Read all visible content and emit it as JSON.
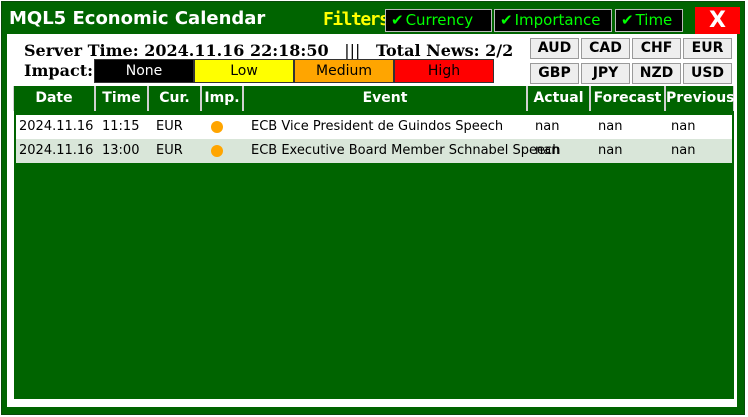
{
  "window": {
    "title": "MQL5 Economic Calendar",
    "close_label": "X"
  },
  "filters": {
    "label": "Filters:",
    "items": [
      {
        "check": "✔",
        "label": "Currency"
      },
      {
        "check": "✔",
        "label": "Importance"
      },
      {
        "check": "✔",
        "label": "Time"
      }
    ]
  },
  "server": {
    "time_label": "Server Time:",
    "time_value": "2024.11.16 22:18:50",
    "separator": "|||",
    "news_label": "Total News:",
    "news_value": "2/2"
  },
  "impact": {
    "label": "Impact:",
    "levels": [
      {
        "label": "None",
        "bg": "#000000",
        "fg": "#ffffff"
      },
      {
        "label": "Low",
        "bg": "#ffff00",
        "fg": "#000000"
      },
      {
        "label": "Medium",
        "bg": "#ffa500",
        "fg": "#000000"
      },
      {
        "label": "High",
        "bg": "#ff0000",
        "fg": "#000000"
      }
    ]
  },
  "currencies": [
    "AUD",
    "CAD",
    "CHF",
    "EUR",
    "GBP",
    "JPY",
    "NZD",
    "USD"
  ],
  "table": {
    "headers": [
      "Date",
      "Time",
      "Cur.",
      "Imp.",
      "Event",
      "Actual",
      "Forecast",
      "Previous"
    ],
    "rows": [
      {
        "date": "2024.11.16",
        "time": "11:15",
        "cur": "EUR",
        "imp_color": "#ffa500",
        "event": "ECB Vice President de Guindos Speech",
        "actual": "nan",
        "forecast": "nan",
        "previous": "nan"
      },
      {
        "date": "2024.11.16",
        "time": "13:00",
        "cur": "EUR",
        "imp_color": "#ffa500",
        "event": "ECB Executive Board Member Schnabel Speech",
        "actual": "nan",
        "forecast": "nan",
        "previous": "nan"
      }
    ]
  },
  "colors": {
    "panel": "#006400",
    "row_alt": "#d9e6d9",
    "filter_text": "#00ff00",
    "filters_label": "#ffff00"
  }
}
